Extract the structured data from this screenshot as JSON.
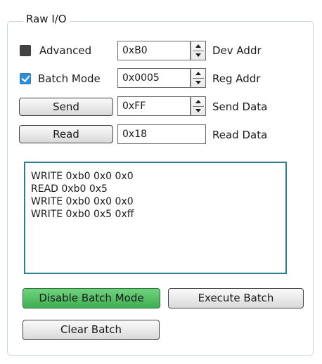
{
  "group": {
    "title": "Raw I/O"
  },
  "options": {
    "advanced": {
      "label": "Advanced",
      "checked": false
    },
    "batch_mode": {
      "label": "Batch Mode",
      "checked": true
    }
  },
  "fields": {
    "dev_addr": {
      "value": "0xB0",
      "label": "Dev Addr"
    },
    "reg_addr": {
      "value": "0x0005",
      "label": "Reg Addr"
    },
    "send_data": {
      "value": "0xFF",
      "label": "Send Data"
    },
    "read_data": {
      "value": "0x18",
      "label": "Read Data"
    }
  },
  "buttons": {
    "send": "Send",
    "read": "Read",
    "disable_batch": "Disable Batch Mode",
    "execute_batch": "Execute Batch",
    "clear_batch": "Clear Batch"
  },
  "log": {
    "lines": [
      "WRITE 0xb0 0x0 0x0",
      "READ 0xb0 0x5",
      "WRITE 0xb0 0x0 0x0",
      "WRITE 0xb0 0x5 0xff"
    ]
  },
  "colors": {
    "accent_green": "#4cbf5e",
    "log_border": "#2c7f90",
    "checkbox_checked": "#2f8fd6"
  }
}
